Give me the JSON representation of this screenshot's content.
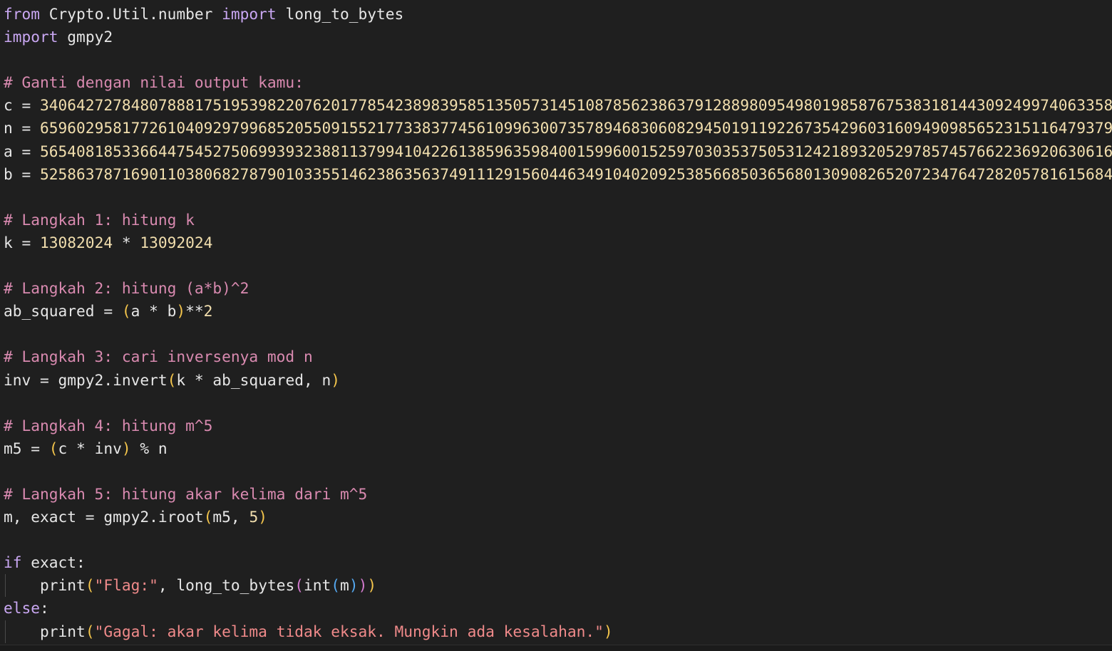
{
  "editor": {
    "lines": [
      [
        {
          "t": "from",
          "c": "kw"
        },
        {
          "t": " Crypto.Util.number "
        },
        {
          "t": "import",
          "c": "kw"
        },
        {
          "t": " long_to_bytes"
        }
      ],
      [
        {
          "t": "import",
          "c": "kw"
        },
        {
          "t": " gmpy2"
        }
      ],
      [],
      [
        {
          "t": "# Ganti dengan nilai output kamu:",
          "c": "cm"
        }
      ],
      [
        {
          "t": "c = "
        },
        {
          "t": "3406427278480788817519539822076201778542389839585135057314510878562386379128898095498019858767538318144309249974063358",
          "c": "num"
        }
      ],
      [
        {
          "t": "n = "
        },
        {
          "t": "6596029581772610409297996852055091552177338377456109963007357894683060829450191192267354296031609490985652315116479379",
          "c": "num"
        }
      ],
      [
        {
          "t": "a = "
        },
        {
          "t": "5654081853366447545275069939323881137994104226138596359840015996001525970303537505312421893205297857457662236920630616",
          "c": "num"
        }
      ],
      [
        {
          "t": "b = "
        },
        {
          "t": "5258637871690110380682787901033551462386356374911129156044634910402092538566850365680130908265207234764728205781615684",
          "c": "num"
        }
      ],
      [],
      [
        {
          "t": "# Langkah 1: hitung k",
          "c": "cm"
        }
      ],
      [
        {
          "t": "k = "
        },
        {
          "t": "13082024",
          "c": "num"
        },
        {
          "t": " * "
        },
        {
          "t": "13092024",
          "c": "num"
        }
      ],
      [],
      [
        {
          "t": "# Langkah 2: hitung (a*b)^2",
          "c": "cm"
        }
      ],
      [
        {
          "t": "ab_squared = "
        },
        {
          "t": "(",
          "c": "p1"
        },
        {
          "t": "a * b"
        },
        {
          "t": ")",
          "c": "p1"
        },
        {
          "t": "**"
        },
        {
          "t": "2",
          "c": "num"
        }
      ],
      [],
      [
        {
          "t": "# Langkah 3: cari inversenya mod n",
          "c": "cm"
        }
      ],
      [
        {
          "t": "inv = gmpy2.invert"
        },
        {
          "t": "(",
          "c": "p1"
        },
        {
          "t": "k * ab_squared, n"
        },
        {
          "t": ")",
          "c": "p1"
        }
      ],
      [],
      [
        {
          "t": "# Langkah 4: hitung m^5",
          "c": "cm"
        }
      ],
      [
        {
          "t": "m5 = "
        },
        {
          "t": "(",
          "c": "p1"
        },
        {
          "t": "c * inv"
        },
        {
          "t": ")",
          "c": "p1"
        },
        {
          "t": " % n"
        }
      ],
      [],
      [
        {
          "t": "# Langkah 5: hitung akar kelima dari m^5",
          "c": "cm"
        }
      ],
      [
        {
          "t": "m, exact = gmpy2.iroot"
        },
        {
          "t": "(",
          "c": "p1"
        },
        {
          "t": "m5, "
        },
        {
          "t": "5",
          "c": "num"
        },
        {
          "t": ")",
          "c": "p1"
        }
      ],
      [],
      [
        {
          "t": "if",
          "c": "kw"
        },
        {
          "t": " exact:"
        }
      ],
      [
        {
          "t": "    print"
        },
        {
          "t": "(",
          "c": "p1"
        },
        {
          "t": "\"Flag:\"",
          "c": "str"
        },
        {
          "t": ", long_to_bytes"
        },
        {
          "t": "(",
          "c": "p2"
        },
        {
          "t": "int"
        },
        {
          "t": "(",
          "c": "p3"
        },
        {
          "t": "m"
        },
        {
          "t": ")",
          "c": "p3"
        },
        {
          "t": ")",
          "c": "p2"
        },
        {
          "t": ")",
          "c": "p1"
        }
      ],
      [
        {
          "t": "else",
          "c": "kw"
        },
        {
          "t": ":"
        }
      ],
      [
        {
          "t": "    print"
        },
        {
          "t": "(",
          "c": "p1"
        },
        {
          "t": "\"Gagal: akar kelima tidak eksak. Mungkin ada kesalahan.\"",
          "c": "str"
        },
        {
          "t": ")",
          "c": "p1"
        }
      ]
    ]
  }
}
